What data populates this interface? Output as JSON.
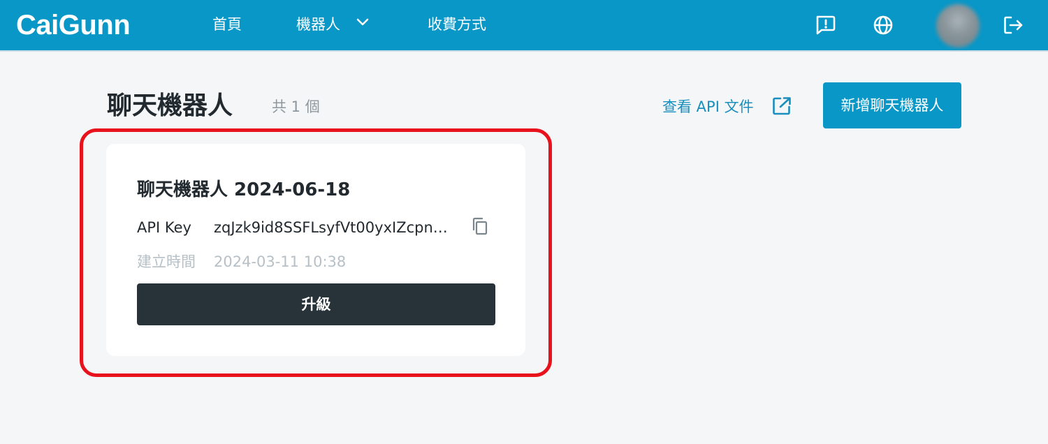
{
  "header": {
    "logo": "CaiGunn",
    "nav": [
      {
        "label": "首頁"
      },
      {
        "label": "機器人",
        "icon": "chevron-down-icon"
      },
      {
        "label": "收費方式"
      }
    ],
    "icons": [
      "feedback-icon",
      "globe-icon",
      "avatar",
      "logout-icon"
    ],
    "brand_color": "#0897c7"
  },
  "main": {
    "title": "聊天機器人",
    "count_label": "共 1 個",
    "api_docs_label": "查看 API 文件",
    "new_bot_label": "新增聊天機器人",
    "highlight_color": "#e8121c"
  },
  "bots": [
    {
      "name": "聊天機器人 2024-06-18",
      "api_key_label": "API Key",
      "api_key_value": "zqJzk9id8SSFLsyfVt00yxIZcpnI…",
      "created_label": "建立時間",
      "created_value": "2024-03-11 10:38",
      "upgrade_label": "升級"
    }
  ]
}
